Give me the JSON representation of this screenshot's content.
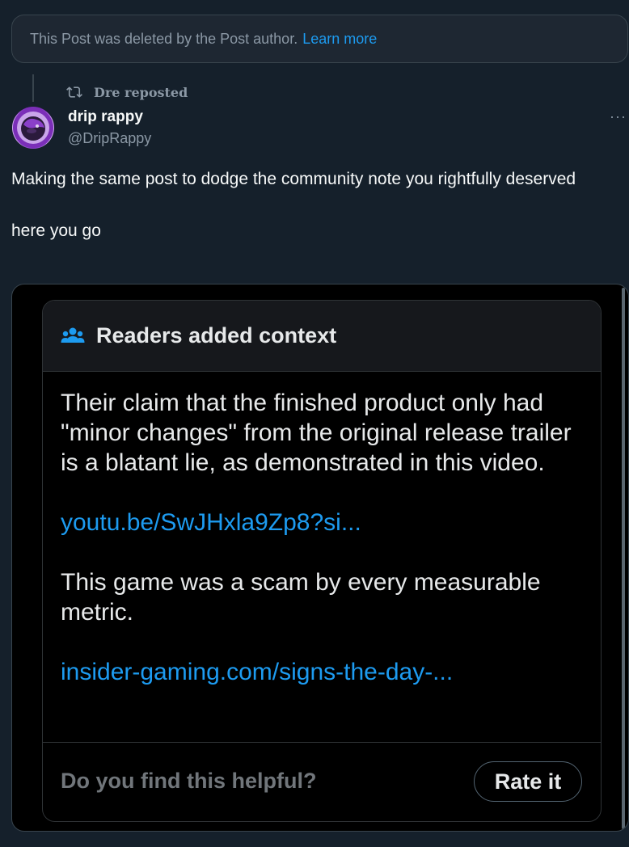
{
  "deleted_banner": {
    "message": "This Post was deleted by the Post author.",
    "link_label": "Learn more"
  },
  "repost": {
    "icon": "repost-icon",
    "label": "Dre reposted"
  },
  "author": {
    "display_name": "drip rappy",
    "handle": "@DripRappy",
    "more_label": "···"
  },
  "post": {
    "line1": "Making the same post to dodge the community note you rightfully deserved",
    "line2": "here you go"
  },
  "community_note": {
    "header_icon": "people-icon",
    "header_title": "Readers added context",
    "paragraph1": "Their claim that the finished product only had \"minor changes\" from the original release trailer is a blatant lie, as demonstrated in this video.",
    "link1": "youtu.be/SwJHxla9Zp8?si...",
    "paragraph2": "This game was a scam by every measurable metric.",
    "link2": "insider-gaming.com/signs-the-day-...",
    "footer_question": "Do you find this helpful?",
    "rate_button": "Rate it"
  },
  "colors": {
    "background": "#15202b",
    "accent": "#1d9bf0",
    "muted": "#8b98a5"
  }
}
